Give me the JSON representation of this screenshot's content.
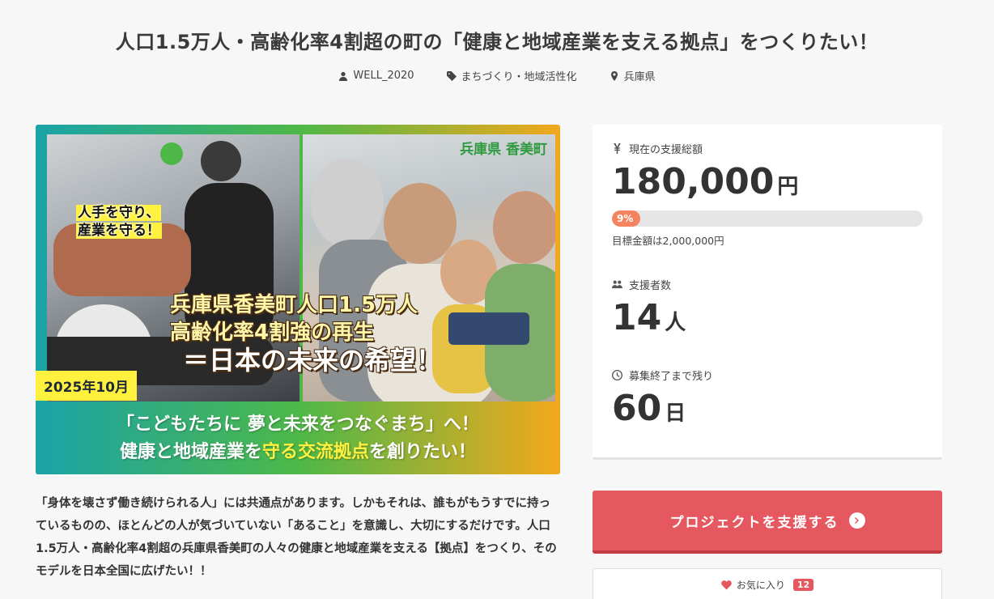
{
  "project": {
    "title": "人口1.5万人・高齢化率4割超の町の「健康と地域産業を支える拠点」をつくりたい！",
    "author": "WELL_2020",
    "category": "まちづくり・地域活性化",
    "location": "兵庫県"
  },
  "hero": {
    "location_tag": "兵庫県 香美町",
    "note_line1": "人手を守り、",
    "note_line2": "産業を守る！",
    "main_line1": "兵庫県香美町人口1.5万人",
    "main_line2": "高齢化率4割強の再生",
    "main_line3": "＝日本の未来の希望！",
    "date_badge": "2025年10月",
    "band_line1": "「こどもたちに 夢と未来をつなぐまち」へ！",
    "band_line2_prefix": "健康と地域産業を",
    "band_line2_highlight": "守る交流拠点",
    "band_line2_suffix": "を創りたい！"
  },
  "description": "「身体を壊さず働き続けられる人」には共通点があります。しかもそれは、誰もがもうすでに持っているものの、ほとんどの人が気づいていない「あること」を意識し、大切にするだけです。人口1.5万人・高齢化率4割超の兵庫県香美町の人々の健康と地域産業を支える【拠点】をつくり、そのモデルを日本全国に広げたい！！",
  "funding": {
    "total_label": "現在の支援総額",
    "total_amount": "180,000",
    "total_unit": "円",
    "percent_label": "9%",
    "progress_fraction": 0.09,
    "goal_text": "目標金額は2,000,000円",
    "supporters_label": "支援者数",
    "supporters_count": "14",
    "supporters_unit": "人",
    "remaining_label": "募集終了まで残り",
    "remaining_count": "60",
    "remaining_unit": "日"
  },
  "actions": {
    "support_label": "プロジェクトを支援する",
    "favorite_label": "お気に入り",
    "favorite_count": "12"
  },
  "colors": {
    "accent": "#e5585f",
    "progress": "#f4845f"
  },
  "icons": {
    "author": "person-icon",
    "category": "tag-icon",
    "location": "map-pin-icon",
    "total": "yen-icon",
    "supporters": "users-icon",
    "remaining": "clock-icon",
    "support": "arrow-circle-right-icon",
    "favorite": "heart-icon"
  }
}
